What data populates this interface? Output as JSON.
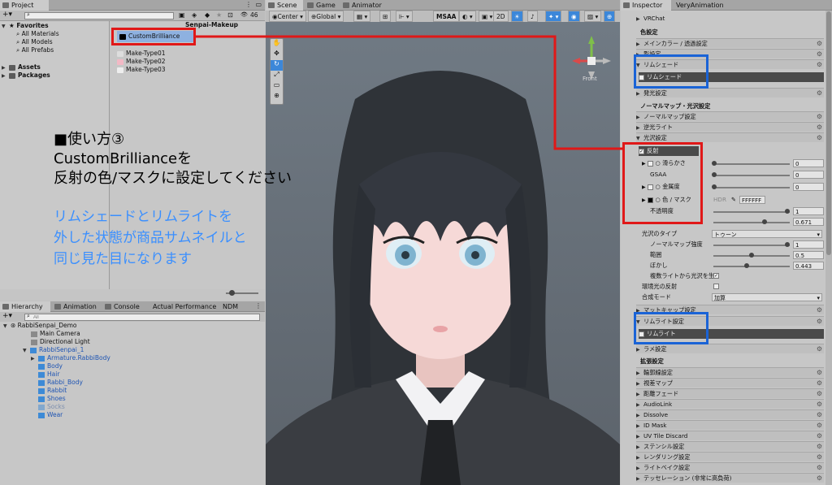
{
  "project": {
    "tab": "Project",
    "count": "46",
    "search_placeholder": "",
    "favorites": {
      "label": "Favorites",
      "items": [
        "All Materials",
        "All Models",
        "All Prefabs"
      ]
    },
    "roots": [
      "Assets",
      "Packages"
    ],
    "path_tail": "Senpai-Makeup",
    "files": [
      "CustomBrilliance",
      "Make-Type01",
      "Make-Type02",
      "Make-Type03"
    ]
  },
  "hierarchy": {
    "tabs": [
      "Hierarchy",
      "Animation",
      "Console",
      "Actual Performance",
      "NDM"
    ],
    "search_placeholder": "All",
    "scene": "RabbiSenpai_Demo",
    "items": [
      "Main Camera",
      "Directional Light",
      "RabbiSenpai_1",
      "Armature.RabbiBody",
      "Body",
      "Hair",
      "Rabbi_Body",
      "Rabbit",
      "Shoes",
      "Socks",
      "Wear"
    ]
  },
  "scene": {
    "tabs": [
      "Scene",
      "Game",
      "Animator"
    ],
    "pivot": "Center",
    "space": "Global",
    "msaa": "MSAA",
    "mode2d": "2D",
    "gizmo_label": "Front"
  },
  "overlay": {
    "title_line1": "■使い方③",
    "title_line2": "CustomBrillianceを",
    "title_line3": "反射の色/マスクに設定してください",
    "note_line1": "リムシェードとリムライトを",
    "note_line2": "外した状態が商品サムネイルと",
    "note_line3": "同じ見た目になります"
  },
  "inspector": {
    "tabs": [
      "Inspector",
      "VeryAnimation"
    ],
    "vrchat": "VRChat",
    "color_section": "色設定",
    "main_color": "メインカラー / 透過設定",
    "shadow": "影設定",
    "rim_shade_hdr": "リムシェード",
    "rim_shade_toggle": "リムシェード",
    "emission": "発光設定",
    "normal_section": "ノーマルマップ・光沢設定",
    "normal_map": "ノーマルマップ設定",
    "backlight": "逆光ライト",
    "gloss": "光沢設定",
    "reflection": "反射",
    "smoothness": "滑らかさ",
    "smoothness_val": "0",
    "gsaa": "GSAA",
    "gsaa_val": "0",
    "metallic": "金属度",
    "metallic_val": "0",
    "color_mask": "色 / マスク",
    "hdr": "HDR",
    "color_hex": "FFFFFF",
    "opacity": "不透明度",
    "opacity_val": "1",
    "hidden_val": "0.671",
    "gloss_type": "光沢のタイプ",
    "gloss_type_val": "トゥーン",
    "normal_strength": "ノーマルマップ強度",
    "normal_strength_val": "1",
    "range": "範囲",
    "range_val": "0.5",
    "blur": "ぼかし",
    "blur_val": "0.443",
    "multi_light": "複数ライトから光沢を生成",
    "env_reflect": "環境光の反射",
    "blend_mode": "合成モード",
    "blend_mode_val": "加算",
    "matcap": "マットキャップ設定",
    "rim_light_hdr": "リムライト設定",
    "rim_light_toggle": "リムライト",
    "glitter": "ラメ設定",
    "ext_section": "拡張設定",
    "ext_items": [
      "輪郭線設定",
      "視差マップ",
      "距離フェード",
      "AudioLink",
      "Dissolve",
      "ID Mask",
      "UV Tile Discard",
      "ステンシル設定",
      "レンダリング設定",
      "ライトベイク設定",
      "テッセレーション (非常に高負荷)"
    ]
  },
  "colors": {
    "red": "#e01818",
    "blue": "#1a63d6",
    "accent_text": "#3a8fff"
  }
}
